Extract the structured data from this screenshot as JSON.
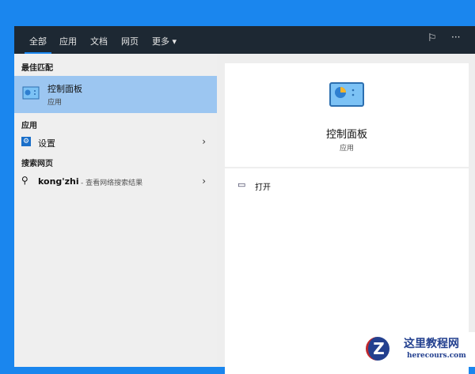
{
  "header": {
    "tabs": [
      {
        "label": "全部"
      },
      {
        "label": "应用"
      },
      {
        "label": "文档"
      },
      {
        "label": "网页"
      },
      {
        "label": "更多 ▾"
      }
    ]
  },
  "left": {
    "best_match_heading": "最佳匹配",
    "best_match": {
      "title": "控制面板",
      "subtitle": "应用"
    },
    "apps_heading": "应用",
    "apps": [
      {
        "label": "设置"
      }
    ],
    "web_heading": "搜索网页",
    "web": {
      "query": "kong'zhi",
      "hint": " - 查看网络搜索结果"
    }
  },
  "right": {
    "title": "控制面板",
    "subtitle": "应用",
    "actions": [
      {
        "label": "打开"
      }
    ]
  },
  "watermark": {
    "name": "这里教程网",
    "url": "herecours.com"
  }
}
